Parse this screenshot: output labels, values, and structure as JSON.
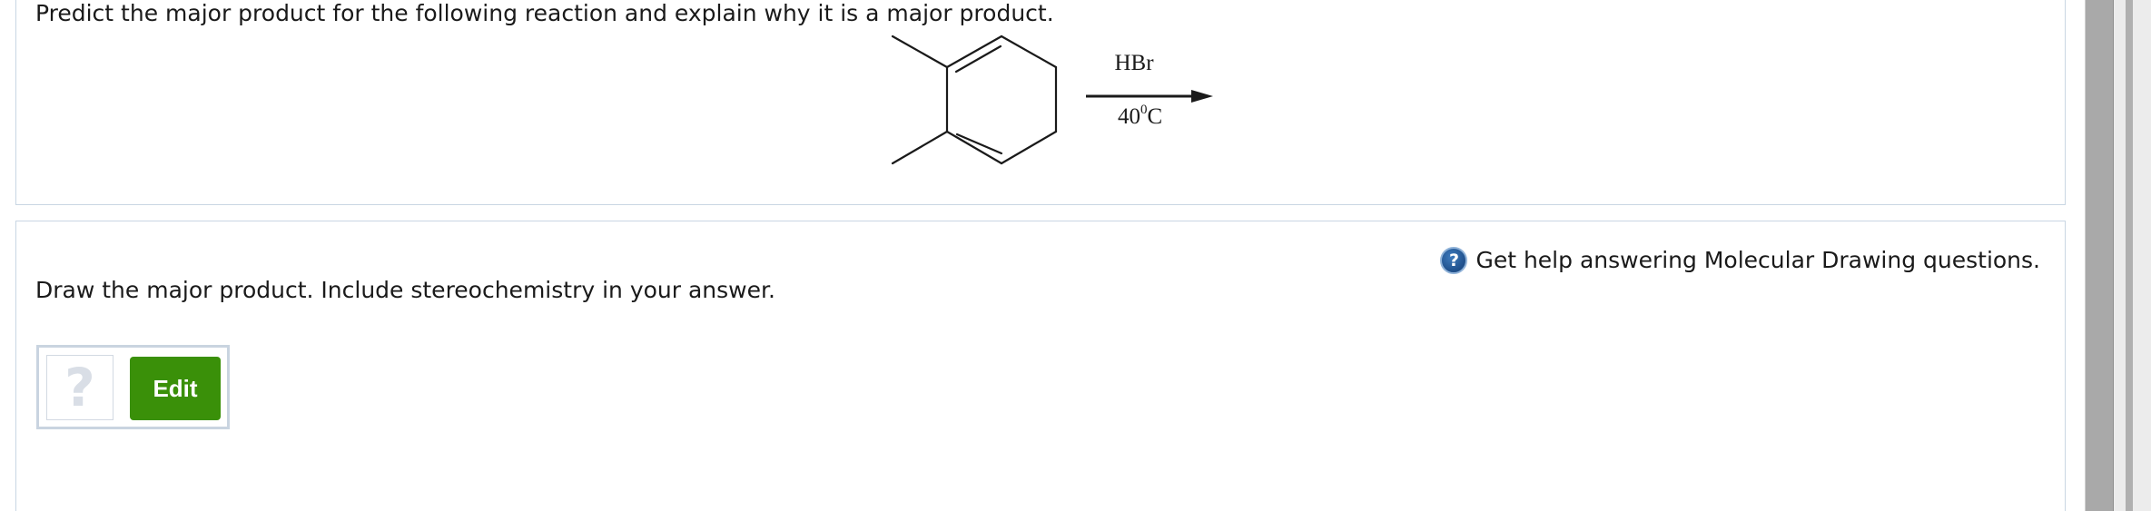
{
  "question": {
    "prompt": "Predict the major product for the following reaction and explain why it is a major product.",
    "reaction": {
      "reagent": "HBr",
      "conditions_number": "40",
      "conditions_degree": "0",
      "conditions_unit": "C"
    }
  },
  "answer": {
    "help_link": "Get help answering Molecular Drawing questions.",
    "help_icon_glyph": "?",
    "instruction": "Draw the major product. Include stereochemistry in your answer.",
    "preview_placeholder": "?",
    "edit_label": "Edit"
  },
  "colors": {
    "edit_button": "#3a9009",
    "help_icon": "#1f4f8a",
    "panel_border": "#c9d6e3"
  }
}
